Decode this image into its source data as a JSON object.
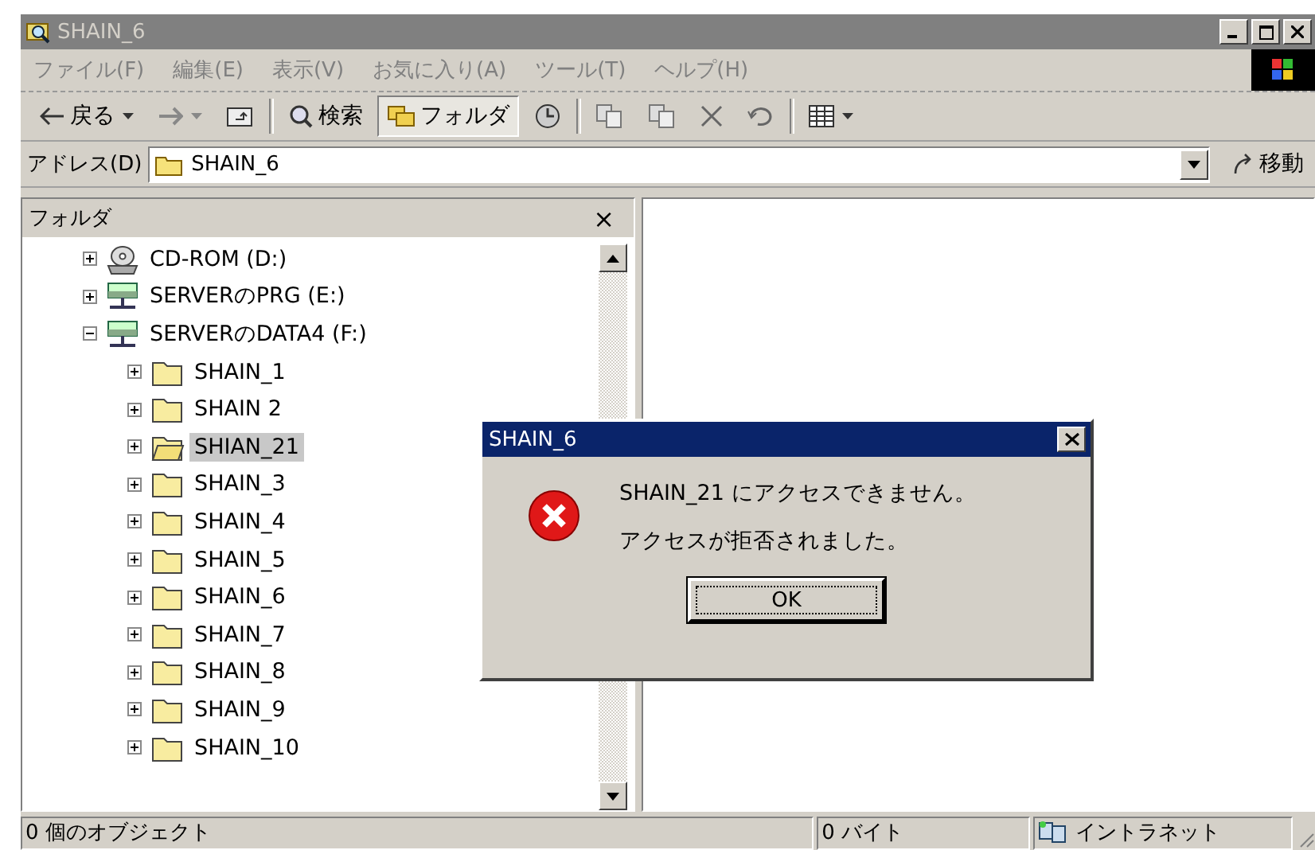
{
  "window": {
    "title": "SHAIN_6"
  },
  "menu": [
    "ファイル(F)",
    "編集(E)",
    "表示(V)",
    "お気に入り(A)",
    "ツール(T)",
    "ヘルプ(H)"
  ],
  "toolbar": [
    {
      "kind": "back",
      "label": "戻る"
    },
    {
      "kind": "forward"
    },
    {
      "kind": "up"
    },
    {
      "kind": "search",
      "label": "検索",
      "selected": false
    },
    {
      "kind": "folders",
      "label": "フォルダ",
      "selected": true
    },
    {
      "kind": "history"
    },
    {
      "kind": "move"
    },
    {
      "kind": "copy"
    },
    {
      "kind": "delete"
    },
    {
      "kind": "undo"
    },
    {
      "kind": "views"
    }
  ],
  "address": {
    "label": "アドレス(D)",
    "value": "SHAIN_6",
    "go": "移動"
  },
  "folder_panel": {
    "title": "フォルダ",
    "close": "×"
  },
  "tree": [
    {
      "kind": "cdrom",
      "label": "CD-ROM (D:)",
      "expanded": false,
      "selected": false
    },
    {
      "kind": "network",
      "label": "SERVERのPRG (E:)",
      "expanded": false,
      "selected": false
    },
    {
      "kind": "network",
      "label": "SERVERのDATA4 (F:)",
      "expanded": true,
      "selected": false,
      "children": [
        {
          "kind": "folder",
          "label": "SHAIN_1",
          "expanded": false,
          "selected": false
        },
        {
          "kind": "folder",
          "label": "SHAIN 2",
          "expanded": false,
          "selected": false
        },
        {
          "kind": "folder",
          "label": "SHIAN_21",
          "expanded": false,
          "selected": true
        },
        {
          "kind": "folder",
          "label": "SHAIN_3",
          "expanded": false,
          "selected": false
        },
        {
          "kind": "folder",
          "label": "SHAIN_4",
          "expanded": false,
          "selected": false
        },
        {
          "kind": "folder",
          "label": "SHAIN_5",
          "expanded": false,
          "selected": false
        },
        {
          "kind": "folder",
          "label": "SHAIN_6",
          "expanded": false,
          "selected": false
        },
        {
          "kind": "folder",
          "label": "SHAIN_7",
          "expanded": false,
          "selected": false
        },
        {
          "kind": "folder",
          "label": "SHAIN_8",
          "expanded": false,
          "selected": false
        },
        {
          "kind": "folder",
          "label": "SHAIN_9",
          "expanded": false,
          "selected": false
        },
        {
          "kind": "folder",
          "label": "SHAIN_10",
          "expanded": false,
          "selected": false
        }
      ]
    }
  ],
  "dialog": {
    "title": "SHAIN_6",
    "messages": [
      "SHAIN_21 にアクセスできません。",
      "アクセスが拒否されました。"
    ],
    "button": "OK"
  },
  "status_bar": {
    "objects": "0 個のオブジェクト",
    "size": "0 バイト",
    "zone": "イントラネット"
  }
}
